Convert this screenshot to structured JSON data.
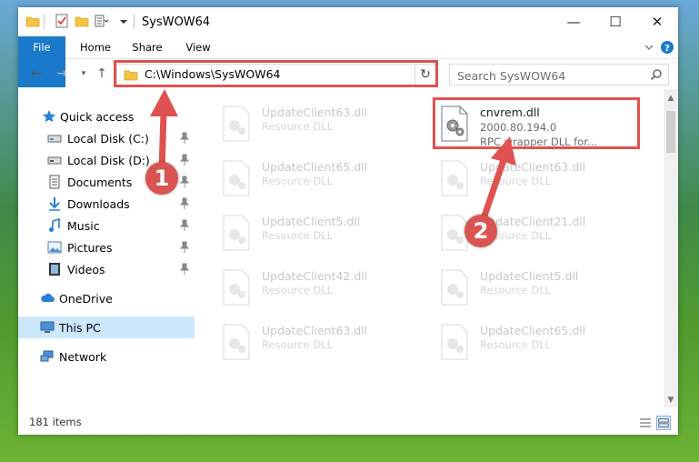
{
  "window": {
    "title": "SysWOW64",
    "controls": {
      "minimize": "—",
      "maximize": "☐",
      "close": "✕"
    }
  },
  "ribbon": {
    "tabs": [
      {
        "label": "File"
      },
      {
        "label": "Home"
      },
      {
        "label": "Share"
      },
      {
        "label": "View"
      }
    ]
  },
  "address": {
    "path": "C:\\Windows\\SysWOW64"
  },
  "search": {
    "placeholder": "Search SysWOW64"
  },
  "nav": {
    "items": [
      {
        "label": "Quick access",
        "icon": "star-icon",
        "pinned": false
      },
      {
        "label": "Local Disk (C:)",
        "icon": "drive-icon",
        "pinned": true
      },
      {
        "label": "Local Disk (D:)",
        "icon": "drive-icon",
        "pinned": true
      },
      {
        "label": "Documents",
        "icon": "documents-icon",
        "pinned": true
      },
      {
        "label": "Downloads",
        "icon": "download-icon",
        "pinned": true
      },
      {
        "label": "Music",
        "icon": "music-icon",
        "pinned": true
      },
      {
        "label": "Pictures",
        "icon": "pictures-icon",
        "pinned": true
      },
      {
        "label": "Videos",
        "icon": "videos-icon",
        "pinned": true
      },
      {
        "label": "OneDrive",
        "icon": "cloud-icon",
        "pinned": false
      },
      {
        "label": "This PC",
        "icon": "computer-icon",
        "pinned": false,
        "selected": true
      },
      {
        "label": "Network",
        "icon": "network-icon",
        "pinned": false
      }
    ]
  },
  "files": [
    {
      "name": "UpdateClient63.dll",
      "desc": "Resource DLL"
    },
    {
      "name": "cnvrem.dll",
      "version": "2000.80.194.0",
      "desc": "RPC wrapper DLL for...",
      "highlighted": true
    },
    {
      "name": "UpdateClient65.dll",
      "desc": "Resource DLL"
    },
    {
      "name": "UpdateClient63.dll",
      "desc": "Resource DLL"
    },
    {
      "name": "UpdateClient5.dll",
      "desc": "Resource DLL"
    },
    {
      "name": "UpdateClient21.dll",
      "desc": "Resource DLL"
    },
    {
      "name": "UpdateClient42.dll",
      "desc": "Resource DLL"
    },
    {
      "name": "UpdateClient5.dll",
      "desc": "Resource DLL"
    },
    {
      "name": "UpdateClient63.dll",
      "desc": "Resource DLL"
    },
    {
      "name": "UpdateClient65.dll",
      "desc": "Resource DLL"
    }
  ],
  "status": {
    "item_count": "181 items"
  },
  "annotations": {
    "callout_1": "1",
    "callout_2": "2",
    "accent_color": "#e0524f"
  },
  "colors": {
    "file_tab": "#1979ca",
    "selection": "#cce8ff",
    "folder": "#f6c443"
  }
}
